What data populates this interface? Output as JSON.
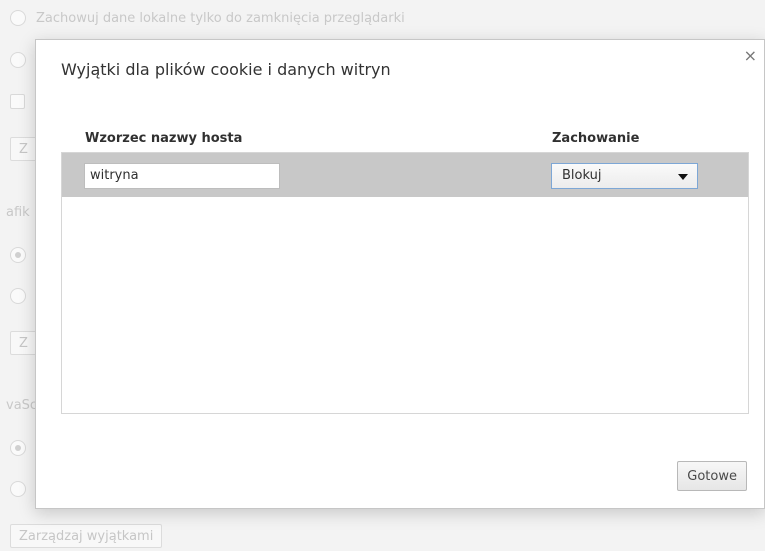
{
  "background": {
    "keep_local_data_label": "Zachowuj dane lokalne tylko do zamknięcia przeglądarki",
    "manage_exceptions_label": "Zarządzaj wyjątkami",
    "images_section_partial": "afik",
    "javascript_section_partial": "vaSc",
    "partial_button_char": "Z"
  },
  "dialog": {
    "title": "Wyjątki dla plików cookie i danych witryn",
    "close_glyph": "×",
    "columns": {
      "host": "Wzorzec nazwy hosta",
      "behavior": "Zachowanie"
    },
    "rows": [
      {
        "host": "witryna",
        "behavior": "Blokuj"
      }
    ],
    "done_label": "Gotowe"
  }
}
